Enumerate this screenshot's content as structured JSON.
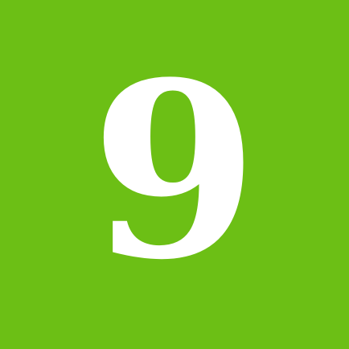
{
  "tile": {
    "digit": "9",
    "background_color": "#6cbf15",
    "digit_color": "#ffffff"
  }
}
